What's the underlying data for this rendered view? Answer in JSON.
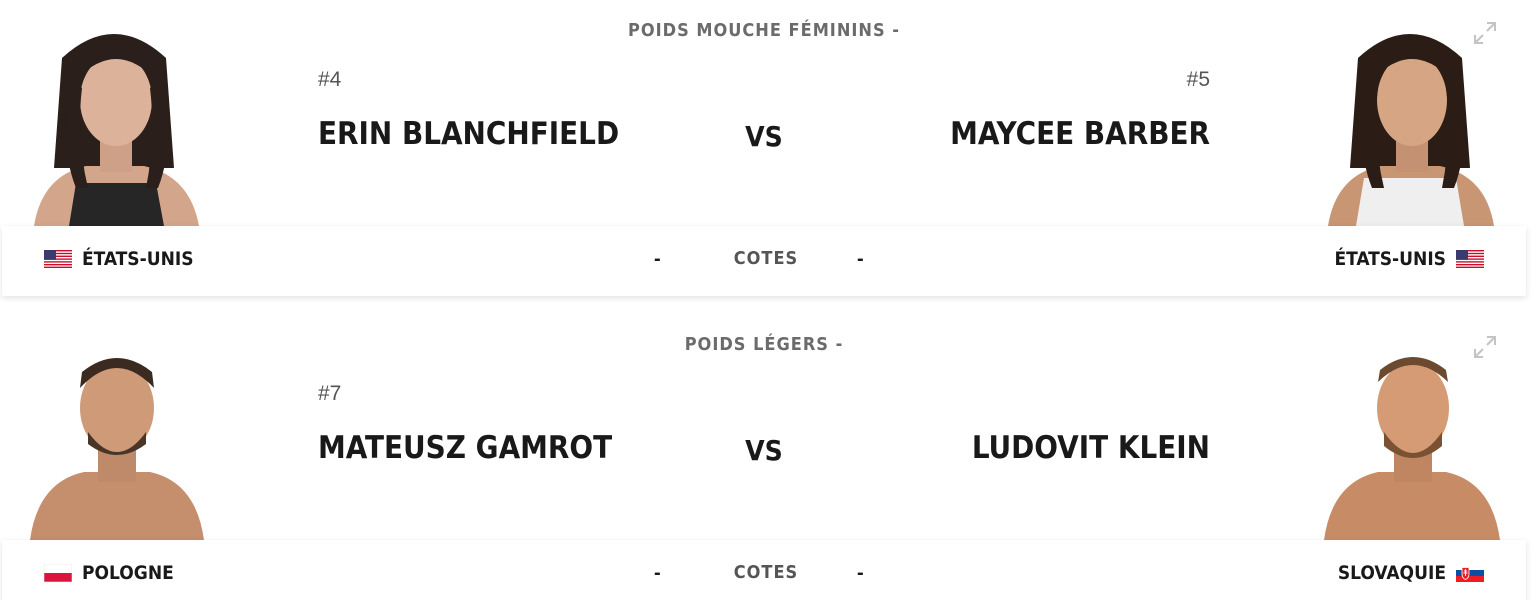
{
  "fights": [
    {
      "weight_class": "POIDS MOUCHE FÉMININS -",
      "vs_label": "VS",
      "odds_label": "COTES",
      "odds_red": "-",
      "odds_blue": "-",
      "red": {
        "rank": "#4",
        "name": "ERIN BLANCHFIELD",
        "country": "ÉTATS-UNIS",
        "flag": "usa-flag-icon"
      },
      "blue": {
        "rank": "#5",
        "name": "MAYCEE BARBER",
        "country": "ÉTATS-UNIS",
        "flag": "usa-flag-icon"
      }
    },
    {
      "weight_class": "POIDS LÉGERS -",
      "vs_label": "VS",
      "odds_label": "COTES",
      "odds_red": "-",
      "odds_blue": "-",
      "red": {
        "rank": "#7",
        "name": "MATEUSZ GAMROT",
        "country": "POLOGNE",
        "flag": "poland-flag-icon"
      },
      "blue": {
        "rank": "",
        "name": "LUDOVIT KLEIN",
        "country": "SLOVAQUIE",
        "flag": "slovakia-flag-icon"
      }
    }
  ],
  "colors": {
    "text": "#191919",
    "muted": "#6b6b6b",
    "background": "#ffffff"
  }
}
